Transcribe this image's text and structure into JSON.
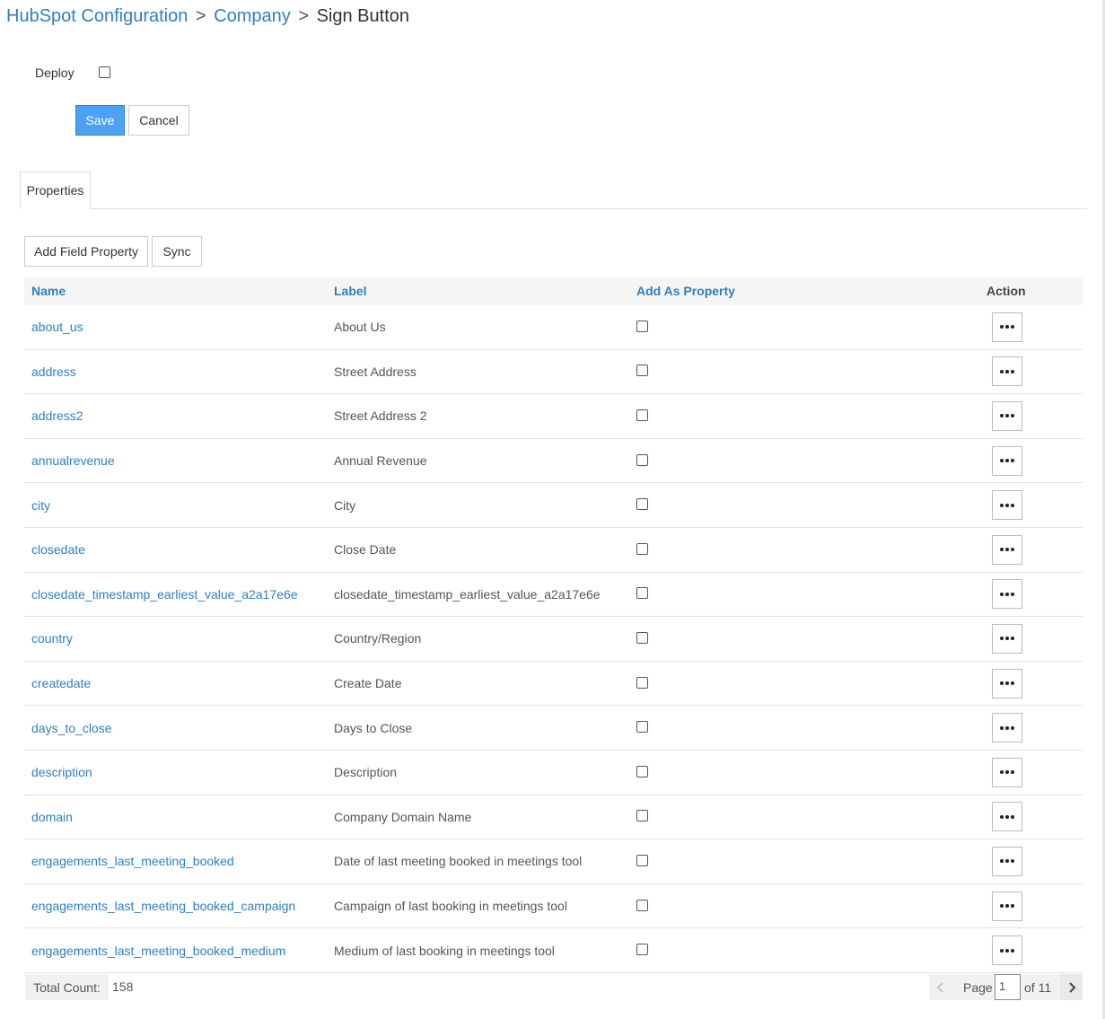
{
  "breadcrumb": {
    "items": [
      "HubSpot Configuration",
      "Company",
      "Sign Button"
    ],
    "separator": ">"
  },
  "form": {
    "deploy_label": "Deploy",
    "deploy_checked": false,
    "save_label": "Save",
    "cancel_label": "Cancel"
  },
  "tabs": [
    {
      "label": "Properties",
      "active": true
    }
  ],
  "toolbar": {
    "add_field_label": "Add Field Property",
    "sync_label": "Sync"
  },
  "table": {
    "columns": {
      "name": "Name",
      "label": "Label",
      "add_as_property": "Add As Property",
      "action": "Action"
    },
    "rows": [
      {
        "name": "about_us",
        "label": "About Us",
        "checked": false
      },
      {
        "name": "address",
        "label": "Street Address",
        "checked": false
      },
      {
        "name": "address2",
        "label": "Street Address 2",
        "checked": false
      },
      {
        "name": "annualrevenue",
        "label": "Annual Revenue",
        "checked": false
      },
      {
        "name": "city",
        "label": "City",
        "checked": false
      },
      {
        "name": "closedate",
        "label": "Close Date",
        "checked": false
      },
      {
        "name": "closedate_timestamp_earliest_value_a2a17e6e",
        "label": "closedate_timestamp_earliest_value_a2a17e6e",
        "checked": false
      },
      {
        "name": "country",
        "label": "Country/Region",
        "checked": false
      },
      {
        "name": "createdate",
        "label": "Create Date",
        "checked": false
      },
      {
        "name": "days_to_close",
        "label": "Days to Close",
        "checked": false
      },
      {
        "name": "description",
        "label": "Description",
        "checked": false
      },
      {
        "name": "domain",
        "label": "Company Domain Name",
        "checked": false
      },
      {
        "name": "engagements_last_meeting_booked",
        "label": "Date of last meeting booked in meetings tool",
        "checked": false
      },
      {
        "name": "engagements_last_meeting_booked_campaign",
        "label": "Campaign of last booking in meetings tool",
        "checked": false
      },
      {
        "name": "engagements_last_meeting_booked_medium",
        "label": "Medium of last booking in meetings tool",
        "checked": false
      }
    ]
  },
  "footer": {
    "total_count_label": "Total Count:",
    "total_count_value": "158",
    "page_label": "Page",
    "page_value": "1",
    "of_label": "of 11"
  },
  "colors": {
    "link": "#2f7fc1",
    "primary_button": "#4ca1f2"
  },
  "icons": {
    "action": "ellipsis-icon",
    "prev": "chevron-left-icon",
    "next": "chevron-right-icon"
  }
}
